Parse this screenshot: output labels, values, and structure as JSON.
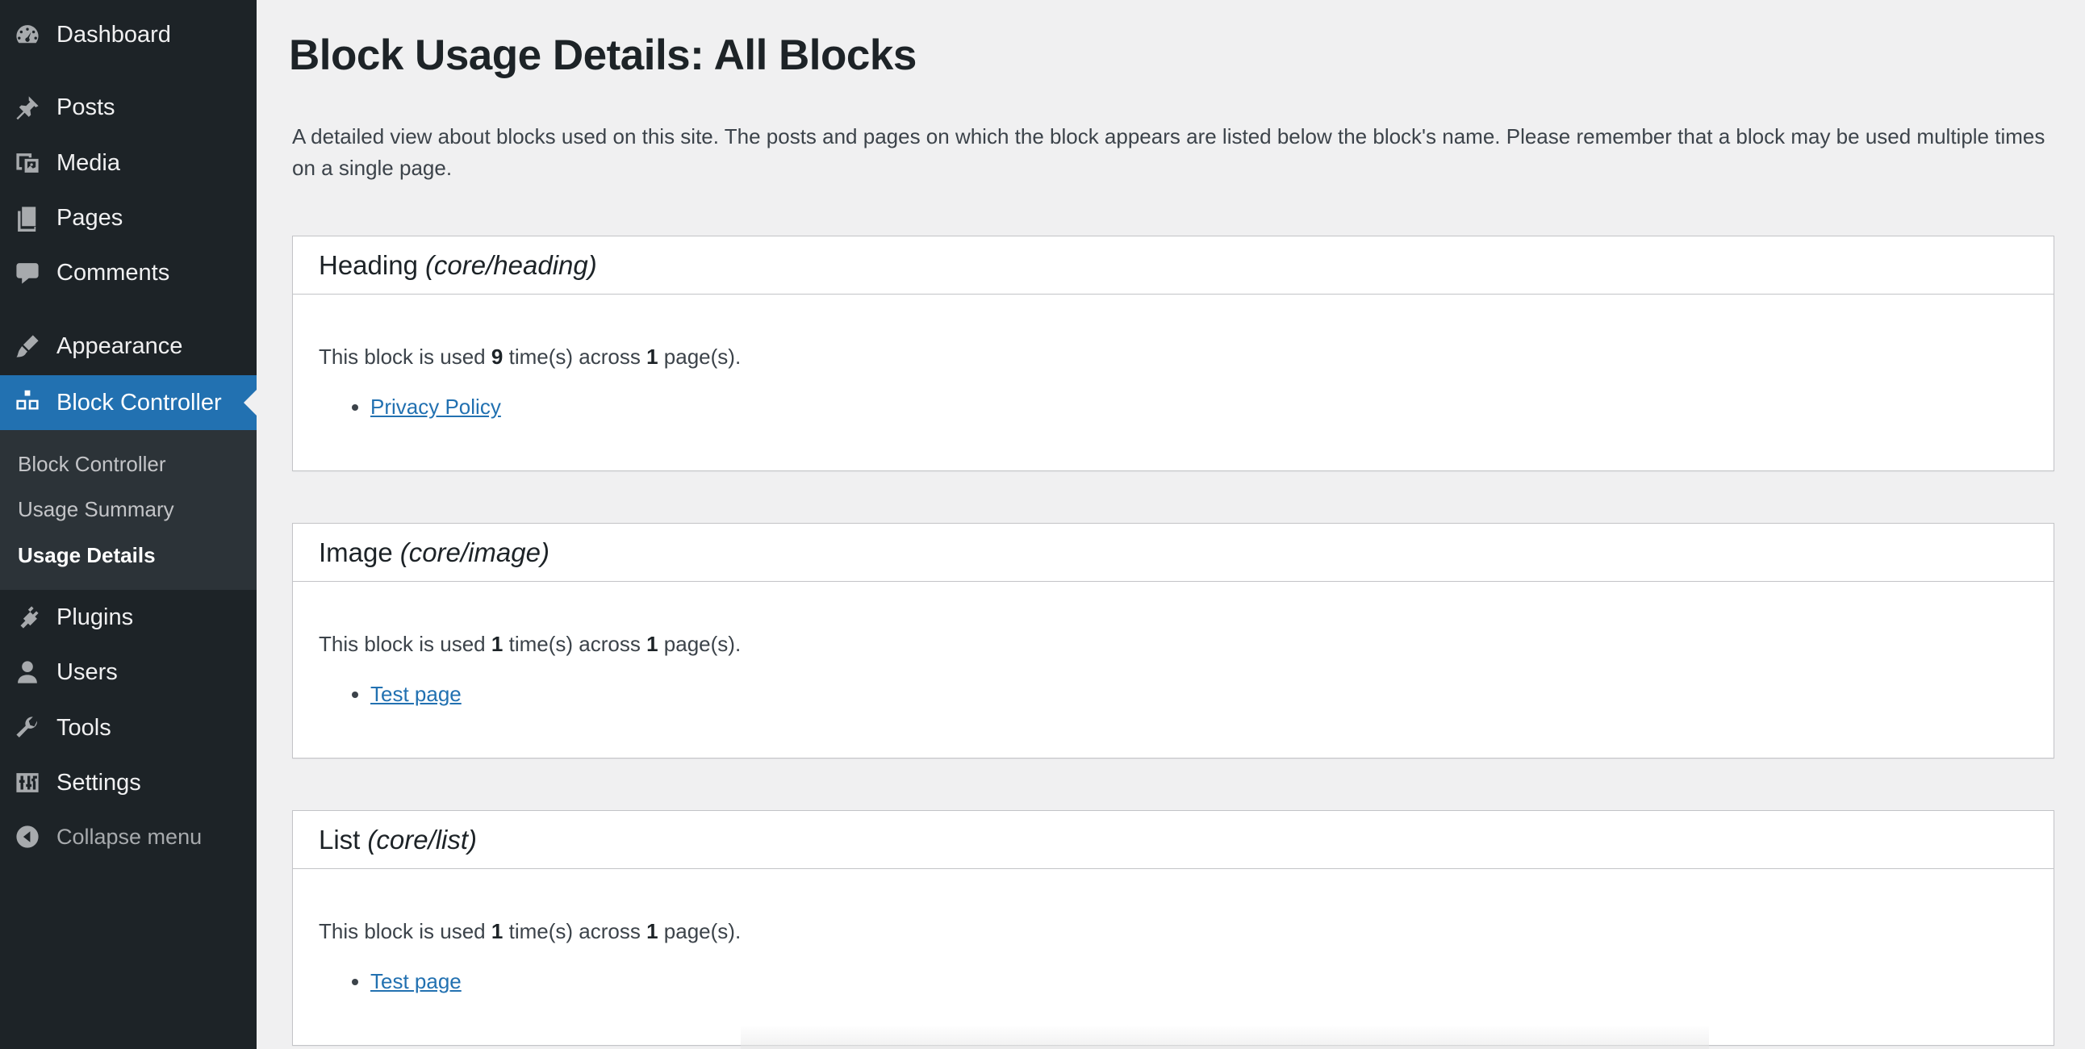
{
  "sidebar": {
    "items": [
      {
        "label": "Dashboard",
        "icon": "dashboard-icon"
      },
      {
        "label": "Posts",
        "icon": "pushpin-icon"
      },
      {
        "label": "Media",
        "icon": "media-icon"
      },
      {
        "label": "Pages",
        "icon": "pages-icon"
      },
      {
        "label": "Comments",
        "icon": "comment-icon"
      },
      {
        "label": "Appearance",
        "icon": "brush-icon"
      },
      {
        "label": "Block Controller",
        "icon": "blocks-icon"
      },
      {
        "label": "Plugins",
        "icon": "plug-icon"
      },
      {
        "label": "Users",
        "icon": "user-icon"
      },
      {
        "label": "Tools",
        "icon": "wrench-icon"
      },
      {
        "label": "Settings",
        "icon": "sliders-icon"
      },
      {
        "label": "Collapse menu",
        "icon": "collapse-arrow-icon"
      }
    ],
    "submenu": [
      {
        "label": "Block Controller"
      },
      {
        "label": "Usage Summary"
      },
      {
        "label": "Usage Details",
        "active": true
      }
    ],
    "colors": {
      "background": "#1d2327",
      "submenu": "#2c3338",
      "accent": "#2271b1"
    }
  },
  "main": {
    "title": "Block Usage Details: All Blocks",
    "intro": "A detailed view about blocks used on this site. The posts and pages on which the block appears are listed below the block's name. Please remember that a block may be used multiple times on a single page.",
    "usage_prefix": "This block is used",
    "usage_mid": "time(s) across",
    "usage_suffix": "page(s).",
    "blocks": [
      {
        "name": "Heading",
        "slug": "(core/heading)",
        "times": "9",
        "pages": "1",
        "links": [
          "Privacy Policy"
        ]
      },
      {
        "name": "Image",
        "slug": "(core/image)",
        "times": "1",
        "pages": "1",
        "links": [
          "Test page"
        ]
      },
      {
        "name": "List",
        "slug": "(core/list)",
        "times": "1",
        "pages": "1",
        "links": [
          "Test page"
        ]
      }
    ]
  }
}
